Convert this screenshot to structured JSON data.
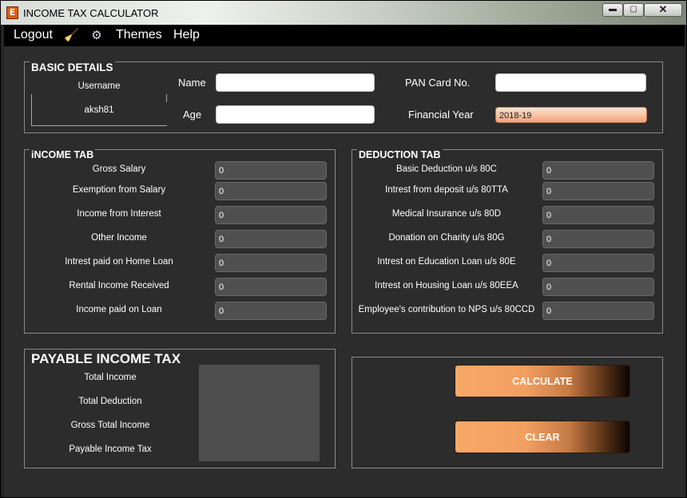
{
  "window": {
    "title": "INCOME TAX CALCULATOR",
    "icon": "E",
    "min": "▬",
    "max": "▢",
    "close": "✕"
  },
  "menu": {
    "logout": "Logout",
    "themes": "Themes",
    "help": "Help"
  },
  "basic": {
    "title": "BASIC DETAILS",
    "username_label": "Username",
    "username_value": "aksh81",
    "name_label": "Name",
    "age_label": "Age",
    "pan_label": "PAN Card No.",
    "fy_label": "Financial Year",
    "fy_value": "2018-19"
  },
  "income": {
    "title": "iNCOME TAB",
    "rows": [
      {
        "label": "Gross Salary",
        "value": "0"
      },
      {
        "label": "Exemption from Salary",
        "value": "0"
      },
      {
        "label": "Income from Interest",
        "value": "0"
      },
      {
        "label": "Other Income",
        "value": "0"
      },
      {
        "label": "Intrest paid on Home Loan",
        "value": "0"
      },
      {
        "label": "Rental Income Received",
        "value": "0"
      },
      {
        "label": "Income paid on Loan",
        "value": "0"
      }
    ]
  },
  "deduction": {
    "title": "DEDUCTION TAB",
    "rows": [
      {
        "label": "Basic Deduction u/s 80C",
        "value": "0"
      },
      {
        "label": "Intrest from deposit u/s 80TTA",
        "value": "0"
      },
      {
        "label": "Medical Insurance u/s 80D",
        "value": "0"
      },
      {
        "label": "Donation on Charity u/s 80G",
        "value": "0"
      },
      {
        "label": "Intrest on Education Loan u/s 80E",
        "value": "0"
      },
      {
        "label": "Intrest on Housing Loan u/s 80EEA",
        "value": "0"
      },
      {
        "label": "Employee's contribution to NPS u/s 80CCD",
        "value": "0"
      }
    ]
  },
  "payable": {
    "title": "PAYABLE INCOME TAX",
    "total_income": "Total Income",
    "total_deduction": "Total Deduction",
    "gross_total_income": "Gross Total Income",
    "payable_tax": "Payable Income Tax"
  },
  "actions": {
    "calculate": "CALCULATE",
    "clear": "CLEAR"
  }
}
